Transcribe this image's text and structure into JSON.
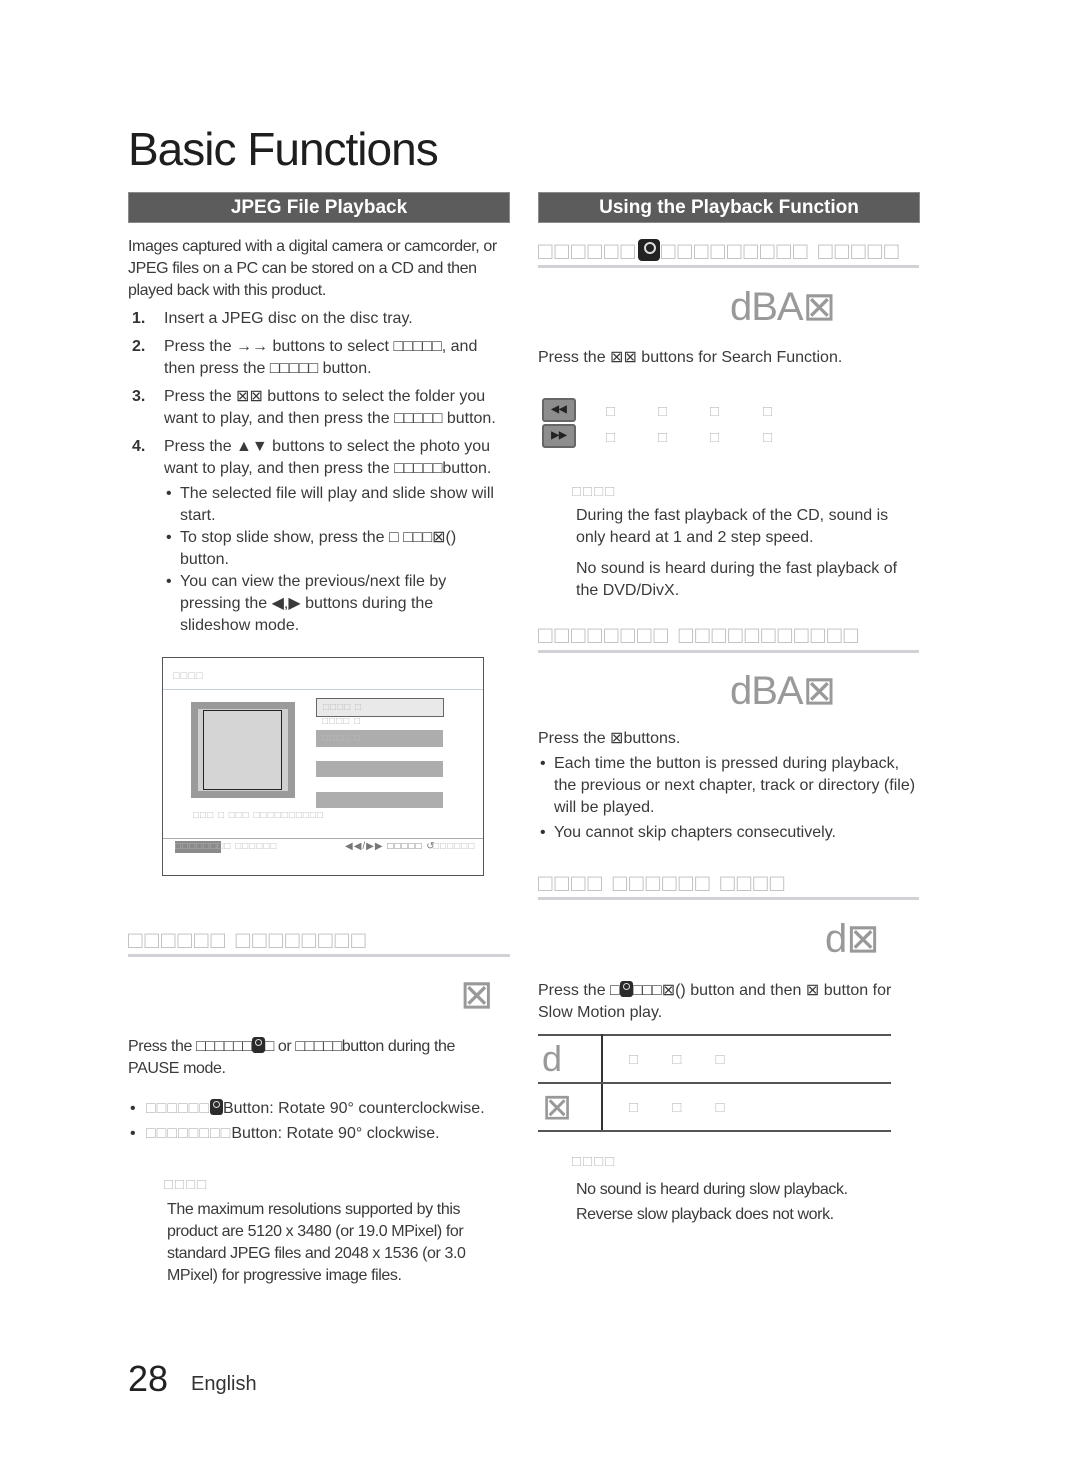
{
  "page": {
    "title": "Basic Functions",
    "page_number": "28",
    "language": "English"
  },
  "left": {
    "section_title": "JPEG File Playback",
    "intro": "Images captured with a digital camera or camcorder, or JPEG files on a PC can be stored on a CD and then played back with this product.",
    "steps": [
      {
        "num": "1.",
        "pre": "Insert a JPEG disc on the disc tray.",
        "l2": ""
      },
      {
        "num": "2.",
        "pre": "Press the →→ buttons to select □□□□□, and",
        "l2": "then press the □□□□□ button."
      },
      {
        "num": "3.",
        "pre": "Press the ⊠⊠   buttons to select the folder you",
        "l2": "want to play, and then press the □□□□□ button."
      },
      {
        "num": "4.",
        "pre": "Press the ▲▼ buttons to select the photo you",
        "l2": "want to play, and then press the □□□□□button."
      }
    ],
    "bullets": [
      "The selected file will play and slide show will start.",
      "To stop slide show, press the □ □□□⊠() button.",
      "You can view the previous/next file by pressing the ◀,▶ buttons during the slideshow mode."
    ],
    "osd": {
      "title": "□□□□",
      "items": [
        "□□□□ □",
        "□□□□ □",
        "□□□□ □"
      ],
      "caption": "□□□ □ □□□ □□□□□□□□□□",
      "footer_left": "□□□□□□□□ □□□□□□",
      "footer_mid": "◀◀/▶▶ □□□□□ ↺",
      "footer_right": "□□□□□□"
    },
    "rotate": {
      "subhead": "□□□□□□ □□□□□□□□",
      "disc_label": "⊠",
      "instruction_a": "Press the □□□□□□",
      "instruction_b": "□ or □□□□□button during the PAUSE mode.",
      "bullet1_a": "□□□□□□",
      "bullet1_b": "Button: Rotate 90° counterclockwise.",
      "bullet2_a": "□□□□□□□□",
      "bullet2_b": "Button: Rotate 90° clockwise.",
      "note_label": "□□□□",
      "note": "The maximum resolutions supported by this product are 5120 x 3480 (or 19.0 MPixel) for standard JPEG files and 2048 x 1536 (or 3.0 MPixel) for progressive image files."
    }
  },
  "right": {
    "section_title": "Using the Playback Function",
    "search": {
      "subhead_a": "□□□□□□",
      "subhead_b": "□□□□□□□□□ □□□□□",
      "disc_labels": "dBA⊠",
      "instruction": "Press the ⊠⊠ buttons for Search Function.",
      "rewind_speeds": [
        "□",
        "□",
        "□",
        "□"
      ],
      "forward_speeds": [
        "□",
        "□",
        "□",
        "□"
      ],
      "rewind_btn": "◀◀",
      "forward_btn": "▶▶",
      "note_label": "□□□□",
      "notes": [
        "During the fast playback of the CD, sound is only heard at 1 and 2 step speed.",
        "No sound is heard during the fast playback of the DVD/DivX."
      ]
    },
    "skip": {
      "subhead": "□□□□□□□□ □□□□□□□□□□□",
      "disc_labels": "dBA⊠",
      "instruction": "Press the ⊠buttons.",
      "bullets": [
        "Each time the button is pressed during playback, the previous or next chapter, track or directory (file) will be played.",
        "You cannot skip chapters consecutively."
      ]
    },
    "slow": {
      "subhead": "□□□□ □□□□□□ □□□□",
      "disc_labels": "d⊠",
      "instruction_a": "Press the □",
      "instruction_b": "□□□⊠() button and then ⊠ button    for Slow Motion play.",
      "table": [
        {
          "key": "d",
          "values": "□ □ □"
        },
        {
          "key": "⊠",
          "values": "□ □ □"
        }
      ],
      "note_label": "□□□□",
      "notes": [
        "No sound is heard during slow playback.",
        "Reverse slow playback does not work."
      ]
    }
  }
}
